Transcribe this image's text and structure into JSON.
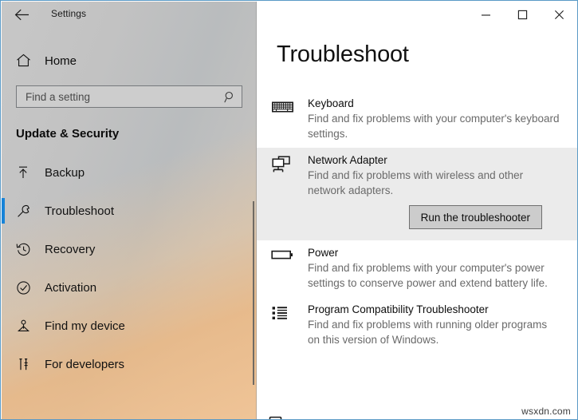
{
  "window": {
    "app_title": "Settings",
    "back_icon": "back-arrow-icon",
    "controls": {
      "minimize_label": "—",
      "maximize_label": "☐",
      "close_label": "✕"
    }
  },
  "sidebar": {
    "home_label": "Home",
    "home_icon": "home-icon",
    "search": {
      "placeholder": "Find a setting",
      "value": "",
      "icon": "search-icon"
    },
    "section_heading": "Update & Security",
    "items": [
      {
        "label": "Backup",
        "icon": "upload-arrow-icon",
        "selected": false
      },
      {
        "label": "Troubleshoot",
        "icon": "wrench-icon",
        "selected": true
      },
      {
        "label": "Recovery",
        "icon": "history-clock-icon",
        "selected": false
      },
      {
        "label": "Activation",
        "icon": "check-circle-icon",
        "selected": false
      },
      {
        "label": "Find my device",
        "icon": "find-device-icon",
        "selected": false
      },
      {
        "label": "For developers",
        "icon": "developer-tools-icon",
        "selected": false
      }
    ]
  },
  "main": {
    "page_title": "Troubleshoot",
    "troubleshooters": [
      {
        "name": "Keyboard",
        "description": "Find and fix problems with your computer's keyboard settings.",
        "icon": "keyboard-icon",
        "selected": false
      },
      {
        "name": "Network Adapter",
        "description": "Find and fix problems with wireless and other network adapters.",
        "icon": "network-adapter-icon",
        "selected": true,
        "action_label": "Run the troubleshooter"
      },
      {
        "name": "Power",
        "description": "Find and fix problems with your computer's power settings to conserve power and extend battery life.",
        "icon": "battery-icon",
        "selected": false
      },
      {
        "name": "Program Compatibility Troubleshooter",
        "description": "Find and fix problems with running older programs on this version of Windows.",
        "icon": "list-icon",
        "selected": false
      }
    ]
  },
  "watermark": "wsxdn.com",
  "colors": {
    "accent": "#1683d8",
    "selected_row": "#ebebeb",
    "button_face": "#cccccc",
    "window_border": "#5a9ac6"
  }
}
